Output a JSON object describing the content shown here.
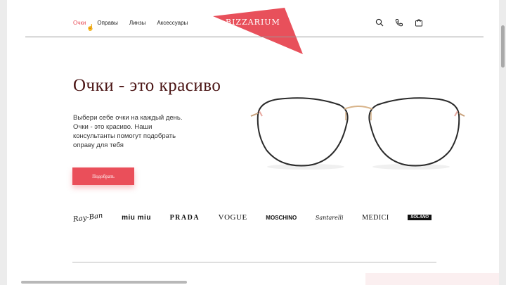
{
  "nav": {
    "items": [
      "Очки",
      "Оправы",
      "Линзы",
      "Аксессуары"
    ],
    "active_index": 0
  },
  "logo": {
    "text": "BIZZARIUM",
    "color": "#e8505b"
  },
  "header_icons": [
    "search-icon",
    "phone-icon",
    "cart-icon"
  ],
  "hero": {
    "title": "Очки - это красиво",
    "text": "Выбери себе очки на каждый день. Очки - это красиво. Наши консультанты помогут подобрать оправу для тебя",
    "button_label": "Подобрать",
    "accent_color": "#ea4f5a"
  },
  "brands": [
    "Ray-Ban",
    "miu miu",
    "PRADA",
    "VOGUE",
    "MOSCHINO",
    "Santarelli",
    "MEDICI",
    "SOLANO"
  ]
}
